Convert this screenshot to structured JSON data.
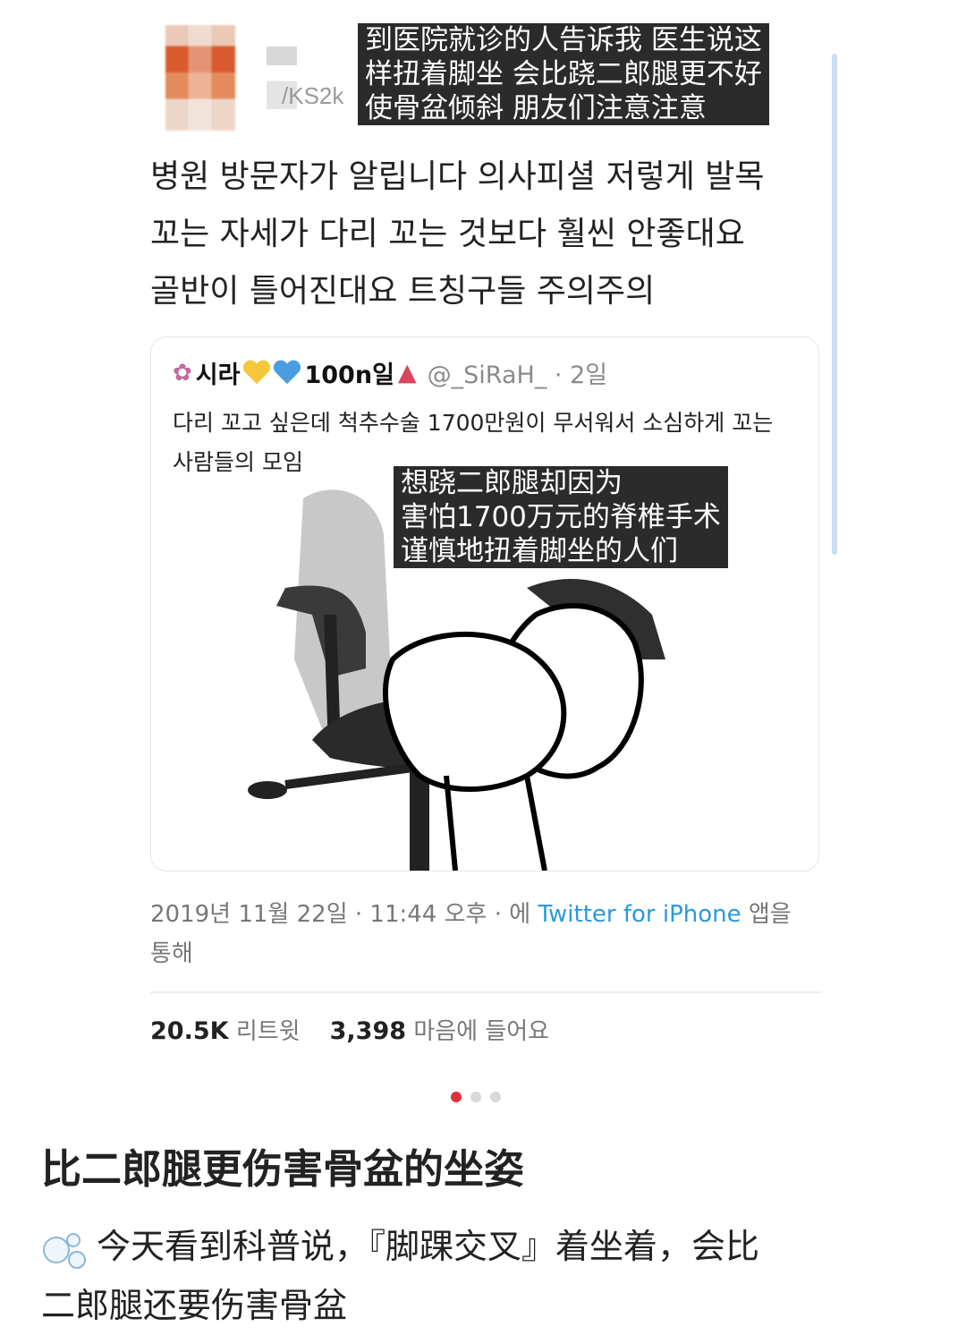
{
  "post": {
    "user_handle": "/KS2k",
    "caption_top": [
      "到医院就诊的人告诉我 医生说这",
      "样扭着脚坐 会比跷二郎腿更不好",
      "使骨盆倾斜 朋友们注意注意"
    ],
    "korean_text": [
      "병원 방문자가 알립니다 의사피셜 저렇게 발목",
      "꼬는 자세가 다리 꼬는 것보다 훨씬 안좋대요",
      "골반이 틀어진대요 트칭구들 주의주의"
    ],
    "quote": {
      "name": "시라",
      "badge": "100n일",
      "handle": "@_SiRaH_ · 2일",
      "text_lines": [
        "다리 꼬고 싶은데 척추수술 1700만원이 무서워서 소심하게 꼬는",
        "사람들의 모임"
      ],
      "caption_lines": [
        "想跷二郎腿却因为",
        "害怕1700万元的脊椎手术",
        "谨慎地扭着脚坐的人们"
      ]
    },
    "meta": {
      "date_prefix": "2019년 11월 22일 · 11:44 오후 · 에 ",
      "app_link": "Twitter for iPhone",
      "suffix": " 앱을",
      "line2": "통해"
    },
    "stats": {
      "retweets_value": "20.5K",
      "retweets_label": "리트윗",
      "likes_value": "3,398",
      "likes_label": "마음에 들어요"
    }
  },
  "carousel": {
    "active_index": 0,
    "count": 3
  },
  "article": {
    "title": "比二郎腿更伤害骨盆的坐姿",
    "body_line1": "今天看到科普说，『脚踝交叉』着坐着，会比",
    "body_line2": "二郎腿还要伤害骨盆"
  },
  "colors": {
    "link": "#2a9bd8",
    "active_dot": "#e0303a",
    "caption_bg": "#2b2b2b"
  }
}
